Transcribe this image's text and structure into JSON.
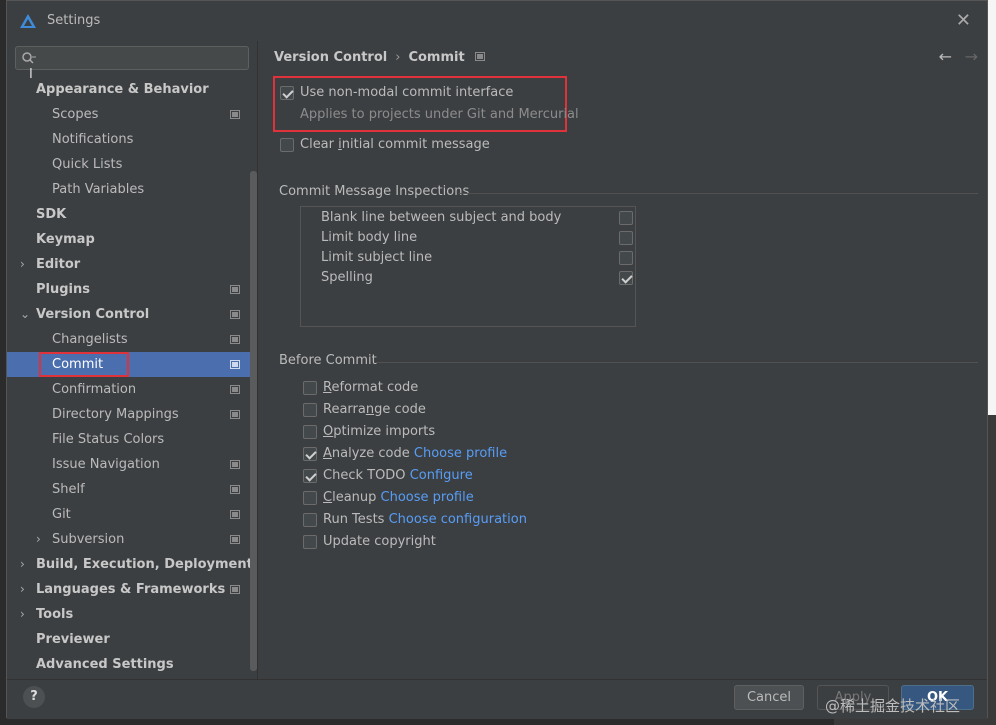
{
  "window": {
    "title": "Settings"
  },
  "search": {
    "placeholder": ""
  },
  "sidebar": {
    "items": [
      {
        "label": "Appearance & Behavior",
        "level": 0,
        "bold": true,
        "arrow": "",
        "proj": false
      },
      {
        "label": "Scopes",
        "level": 1,
        "bold": false,
        "arrow": "",
        "proj": true
      },
      {
        "label": "Notifications",
        "level": 1,
        "bold": false,
        "arrow": "",
        "proj": false
      },
      {
        "label": "Quick Lists",
        "level": 1,
        "bold": false,
        "arrow": "",
        "proj": false
      },
      {
        "label": "Path Variables",
        "level": 1,
        "bold": false,
        "arrow": "",
        "proj": false
      },
      {
        "label": "SDK",
        "level": 0,
        "bold": true,
        "arrow": "",
        "proj": false
      },
      {
        "label": "Keymap",
        "level": 0,
        "bold": true,
        "arrow": "",
        "proj": false
      },
      {
        "label": "Editor",
        "level": 0,
        "bold": true,
        "arrow": "›",
        "proj": false
      },
      {
        "label": "Plugins",
        "level": 0,
        "bold": true,
        "arrow": "",
        "proj": true
      },
      {
        "label": "Version Control",
        "level": 0,
        "bold": true,
        "arrow": "⌄",
        "proj": true
      },
      {
        "label": "Changelists",
        "level": 1,
        "bold": false,
        "arrow": "",
        "proj": true
      },
      {
        "label": "Commit",
        "level": 1,
        "bold": false,
        "arrow": "",
        "proj": true,
        "selected": true
      },
      {
        "label": "Confirmation",
        "level": 1,
        "bold": false,
        "arrow": "",
        "proj": true
      },
      {
        "label": "Directory Mappings",
        "level": 1,
        "bold": false,
        "arrow": "",
        "proj": true
      },
      {
        "label": "File Status Colors",
        "level": 1,
        "bold": false,
        "arrow": "",
        "proj": false
      },
      {
        "label": "Issue Navigation",
        "level": 1,
        "bold": false,
        "arrow": "",
        "proj": true
      },
      {
        "label": "Shelf",
        "level": 1,
        "bold": false,
        "arrow": "",
        "proj": true
      },
      {
        "label": "Git",
        "level": 1,
        "bold": false,
        "arrow": "",
        "proj": true
      },
      {
        "label": "Subversion",
        "level": 1,
        "bold": false,
        "arrow": "›",
        "proj": true
      },
      {
        "label": "Build, Execution, Deployment",
        "level": 0,
        "bold": true,
        "arrow": "›",
        "proj": false
      },
      {
        "label": "Languages & Frameworks",
        "level": 0,
        "bold": true,
        "arrow": "›",
        "proj": true
      },
      {
        "label": "Tools",
        "level": 0,
        "bold": true,
        "arrow": "›",
        "proj": false
      },
      {
        "label": "Previewer",
        "level": 0,
        "bold": true,
        "arrow": "",
        "proj": false
      },
      {
        "label": "Advanced Settings",
        "level": 0,
        "bold": true,
        "arrow": "",
        "proj": false
      }
    ]
  },
  "breadcrumb": {
    "parent": "Version Control",
    "separator": "›",
    "current": "Commit"
  },
  "nav": {
    "back": "←",
    "forward": "→"
  },
  "options": {
    "non_modal": {
      "label": "Use non-modal commit interface",
      "checked": true,
      "hint": "Applies to projects under Git and Mercurial"
    },
    "clear_initial": {
      "prefix": "Clear ",
      "mnemonic": "i",
      "suffix": "nitial commit message",
      "checked": false
    }
  },
  "inspections": {
    "title": "Commit Message Inspections",
    "items": [
      {
        "label": "Blank line between subject and body",
        "checked": false
      },
      {
        "label": "Limit body line",
        "checked": false
      },
      {
        "label": "Limit subject line",
        "checked": false
      },
      {
        "label": "Spelling",
        "checked": true
      }
    ]
  },
  "before_commit": {
    "title": "Before Commit",
    "items": [
      {
        "pre": "",
        "mn": "R",
        "post": "eformat code",
        "link": "",
        "checked": false
      },
      {
        "pre": "Rearra",
        "mn": "n",
        "post": "ge code",
        "link": "",
        "checked": false
      },
      {
        "pre": "",
        "mn": "O",
        "post": "ptimize imports",
        "link": "",
        "checked": false
      },
      {
        "pre": "",
        "mn": "A",
        "post": "nalyze code",
        "link": "Choose profile",
        "checked": true
      },
      {
        "pre": "Check TODO",
        "mn": "",
        "post": "",
        "link": "Configure",
        "checked": true
      },
      {
        "pre": "",
        "mn": "C",
        "post": "leanup",
        "link": "Choose profile",
        "checked": false
      },
      {
        "pre": "Run Tests",
        "mn": "",
        "post": "",
        "link": "Choose configuration",
        "checked": false
      },
      {
        "pre": "Update copyright",
        "mn": "",
        "post": "",
        "link": "",
        "checked": false
      }
    ]
  },
  "footer": {
    "help": "?",
    "cancel": "Cancel",
    "apply": "Apply",
    "ok": "OK"
  },
  "watermark": "@稀土掘金技术社区",
  "colors": {
    "accent": "#4b6eaf",
    "link": "#589df6",
    "highlight": "#e0323a",
    "primary_button": "#365880"
  }
}
